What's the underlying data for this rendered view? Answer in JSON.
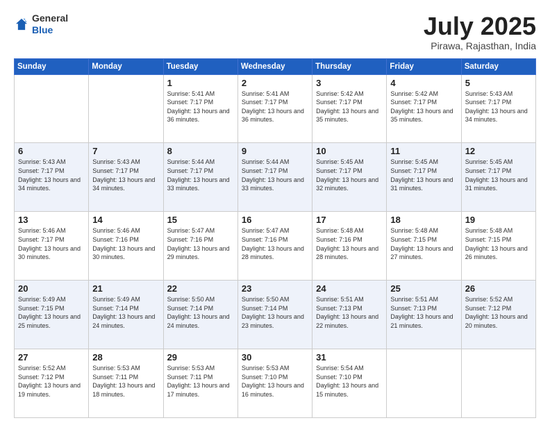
{
  "header": {
    "logo_general": "General",
    "logo_blue": "Blue",
    "month_title": "July 2025",
    "subtitle": "Pirawa, Rajasthan, India"
  },
  "weekdays": [
    "Sunday",
    "Monday",
    "Tuesday",
    "Wednesday",
    "Thursday",
    "Friday",
    "Saturday"
  ],
  "weeks": [
    [
      {
        "day": "",
        "sunrise": "",
        "sunset": "",
        "daylight": ""
      },
      {
        "day": "",
        "sunrise": "",
        "sunset": "",
        "daylight": ""
      },
      {
        "day": "1",
        "sunrise": "Sunrise: 5:41 AM",
        "sunset": "Sunset: 7:17 PM",
        "daylight": "Daylight: 13 hours and 36 minutes."
      },
      {
        "day": "2",
        "sunrise": "Sunrise: 5:41 AM",
        "sunset": "Sunset: 7:17 PM",
        "daylight": "Daylight: 13 hours and 36 minutes."
      },
      {
        "day": "3",
        "sunrise": "Sunrise: 5:42 AM",
        "sunset": "Sunset: 7:17 PM",
        "daylight": "Daylight: 13 hours and 35 minutes."
      },
      {
        "day": "4",
        "sunrise": "Sunrise: 5:42 AM",
        "sunset": "Sunset: 7:17 PM",
        "daylight": "Daylight: 13 hours and 35 minutes."
      },
      {
        "day": "5",
        "sunrise": "Sunrise: 5:43 AM",
        "sunset": "Sunset: 7:17 PM",
        "daylight": "Daylight: 13 hours and 34 minutes."
      }
    ],
    [
      {
        "day": "6",
        "sunrise": "Sunrise: 5:43 AM",
        "sunset": "Sunset: 7:17 PM",
        "daylight": "Daylight: 13 hours and 34 minutes."
      },
      {
        "day": "7",
        "sunrise": "Sunrise: 5:43 AM",
        "sunset": "Sunset: 7:17 PM",
        "daylight": "Daylight: 13 hours and 34 minutes."
      },
      {
        "day": "8",
        "sunrise": "Sunrise: 5:44 AM",
        "sunset": "Sunset: 7:17 PM",
        "daylight": "Daylight: 13 hours and 33 minutes."
      },
      {
        "day": "9",
        "sunrise": "Sunrise: 5:44 AM",
        "sunset": "Sunset: 7:17 PM",
        "daylight": "Daylight: 13 hours and 33 minutes."
      },
      {
        "day": "10",
        "sunrise": "Sunrise: 5:45 AM",
        "sunset": "Sunset: 7:17 PM",
        "daylight": "Daylight: 13 hours and 32 minutes."
      },
      {
        "day": "11",
        "sunrise": "Sunrise: 5:45 AM",
        "sunset": "Sunset: 7:17 PM",
        "daylight": "Daylight: 13 hours and 31 minutes."
      },
      {
        "day": "12",
        "sunrise": "Sunrise: 5:45 AM",
        "sunset": "Sunset: 7:17 PM",
        "daylight": "Daylight: 13 hours and 31 minutes."
      }
    ],
    [
      {
        "day": "13",
        "sunrise": "Sunrise: 5:46 AM",
        "sunset": "Sunset: 7:17 PM",
        "daylight": "Daylight: 13 hours and 30 minutes."
      },
      {
        "day": "14",
        "sunrise": "Sunrise: 5:46 AM",
        "sunset": "Sunset: 7:16 PM",
        "daylight": "Daylight: 13 hours and 30 minutes."
      },
      {
        "day": "15",
        "sunrise": "Sunrise: 5:47 AM",
        "sunset": "Sunset: 7:16 PM",
        "daylight": "Daylight: 13 hours and 29 minutes."
      },
      {
        "day": "16",
        "sunrise": "Sunrise: 5:47 AM",
        "sunset": "Sunset: 7:16 PM",
        "daylight": "Daylight: 13 hours and 28 minutes."
      },
      {
        "day": "17",
        "sunrise": "Sunrise: 5:48 AM",
        "sunset": "Sunset: 7:16 PM",
        "daylight": "Daylight: 13 hours and 28 minutes."
      },
      {
        "day": "18",
        "sunrise": "Sunrise: 5:48 AM",
        "sunset": "Sunset: 7:15 PM",
        "daylight": "Daylight: 13 hours and 27 minutes."
      },
      {
        "day": "19",
        "sunrise": "Sunrise: 5:48 AM",
        "sunset": "Sunset: 7:15 PM",
        "daylight": "Daylight: 13 hours and 26 minutes."
      }
    ],
    [
      {
        "day": "20",
        "sunrise": "Sunrise: 5:49 AM",
        "sunset": "Sunset: 7:15 PM",
        "daylight": "Daylight: 13 hours and 25 minutes."
      },
      {
        "day": "21",
        "sunrise": "Sunrise: 5:49 AM",
        "sunset": "Sunset: 7:14 PM",
        "daylight": "Daylight: 13 hours and 24 minutes."
      },
      {
        "day": "22",
        "sunrise": "Sunrise: 5:50 AM",
        "sunset": "Sunset: 7:14 PM",
        "daylight": "Daylight: 13 hours and 24 minutes."
      },
      {
        "day": "23",
        "sunrise": "Sunrise: 5:50 AM",
        "sunset": "Sunset: 7:14 PM",
        "daylight": "Daylight: 13 hours and 23 minutes."
      },
      {
        "day": "24",
        "sunrise": "Sunrise: 5:51 AM",
        "sunset": "Sunset: 7:13 PM",
        "daylight": "Daylight: 13 hours and 22 minutes."
      },
      {
        "day": "25",
        "sunrise": "Sunrise: 5:51 AM",
        "sunset": "Sunset: 7:13 PM",
        "daylight": "Daylight: 13 hours and 21 minutes."
      },
      {
        "day": "26",
        "sunrise": "Sunrise: 5:52 AM",
        "sunset": "Sunset: 7:12 PM",
        "daylight": "Daylight: 13 hours and 20 minutes."
      }
    ],
    [
      {
        "day": "27",
        "sunrise": "Sunrise: 5:52 AM",
        "sunset": "Sunset: 7:12 PM",
        "daylight": "Daylight: 13 hours and 19 minutes."
      },
      {
        "day": "28",
        "sunrise": "Sunrise: 5:53 AM",
        "sunset": "Sunset: 7:11 PM",
        "daylight": "Daylight: 13 hours and 18 minutes."
      },
      {
        "day": "29",
        "sunrise": "Sunrise: 5:53 AM",
        "sunset": "Sunset: 7:11 PM",
        "daylight": "Daylight: 13 hours and 17 minutes."
      },
      {
        "day": "30",
        "sunrise": "Sunrise: 5:53 AM",
        "sunset": "Sunset: 7:10 PM",
        "daylight": "Daylight: 13 hours and 16 minutes."
      },
      {
        "day": "31",
        "sunrise": "Sunrise: 5:54 AM",
        "sunset": "Sunset: 7:10 PM",
        "daylight": "Daylight: 13 hours and 15 minutes."
      },
      {
        "day": "",
        "sunrise": "",
        "sunset": "",
        "daylight": ""
      },
      {
        "day": "",
        "sunrise": "",
        "sunset": "",
        "daylight": ""
      }
    ]
  ]
}
